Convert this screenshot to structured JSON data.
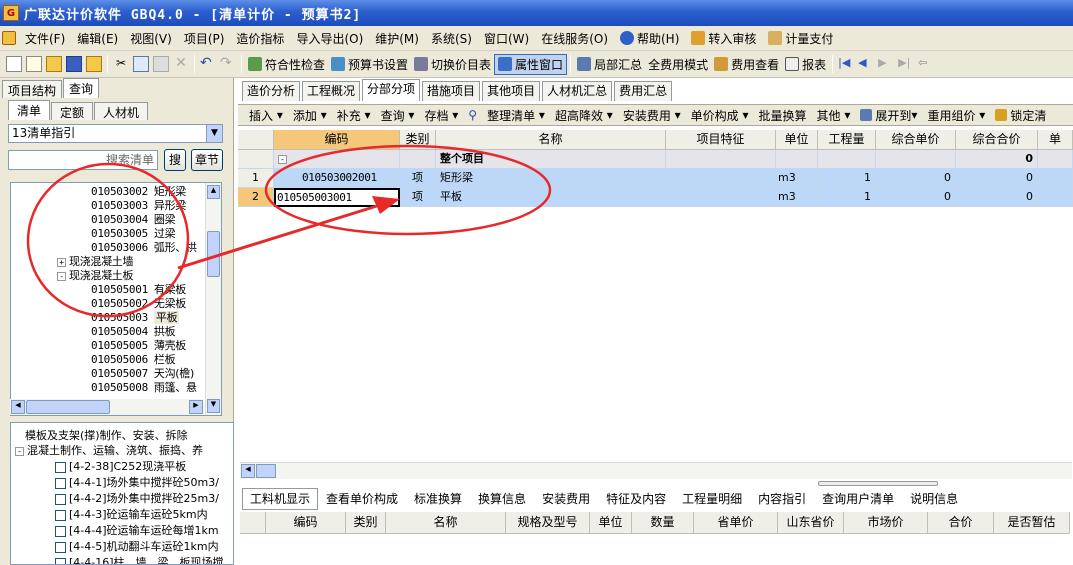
{
  "window": {
    "title": "广联达计价软件 GBQ4.0 - [清单计价 - 预算书2]"
  },
  "menu": [
    "文件(F)",
    "编辑(E)",
    "视图(V)",
    "项目(P)",
    "造价指标",
    "导入导出(O)",
    "维护(M)",
    "系统(S)",
    "窗口(W)",
    "在线服务(O)",
    "帮助(H)",
    "转入审核",
    "计量支付"
  ],
  "toolbar": {
    "check": "符合性检查",
    "budget_settings": "预算书设置",
    "switch_price": "切换价目表",
    "property_window": "属性窗口",
    "local_summary": "局部汇总",
    "all_fee_mode": "全费用模式",
    "fee_view": "费用查看",
    "report": "报表"
  },
  "left": {
    "top_tabs": [
      "项目结构",
      "查询"
    ],
    "sub_tabs": [
      "清单",
      "定额",
      "人材机"
    ],
    "library": "13清单指引",
    "search_placeholder": "搜索清单",
    "search_btn": "搜",
    "chapter_btn": "章节",
    "tree": [
      {
        "code": "010503002",
        "name": "矩形梁"
      },
      {
        "code": "010503003",
        "name": "异形梁"
      },
      {
        "code": "010503004",
        "name": "圈梁"
      },
      {
        "code": "010503005",
        "name": "过梁"
      },
      {
        "code": "010503006",
        "name": "弧形、拱"
      },
      {
        "group": "现浇混凝土墙",
        "expander": "+"
      },
      {
        "group": "现浇混凝土板",
        "expander": "-"
      },
      {
        "code": "010505001",
        "name": "有梁板"
      },
      {
        "code": "010505002",
        "name": "无梁板"
      },
      {
        "code": "010505003",
        "name": "平板"
      },
      {
        "code": "010505004",
        "name": "拱板"
      },
      {
        "code": "010505005",
        "name": "薄壳板"
      },
      {
        "code": "010505006",
        "name": "栏板"
      },
      {
        "code": "010505007",
        "name": "天沟(檐)"
      },
      {
        "code": "010505008",
        "name": "雨篷、悬"
      }
    ],
    "quota": [
      {
        "text": "模板及支架(撑)制作、安装、拆除"
      },
      {
        "text": "混凝土制作、运输、浇筑、振捣、养",
        "expander": "-"
      },
      {
        "text": "[4-2-38]C252现浇平板"
      },
      {
        "text": "[4-4-1]场外集中搅拌砼50m3/"
      },
      {
        "text": "[4-4-2]场外集中搅拌砼25m3/"
      },
      {
        "text": "[4-4-3]砼运输车运砼5km内"
      },
      {
        "text": "[4-4-4]砼运输车运砼每增1km"
      },
      {
        "text": "[4-4-5]机动翻斗车运砼1km内"
      },
      {
        "text": "[4-4-16]柱、墙、梁、板现场搅"
      }
    ]
  },
  "main": {
    "tabs": [
      "造价分析",
      "工程概况",
      "分部分项",
      "措施项目",
      "其他项目",
      "人材机汇总",
      "费用汇总"
    ],
    "tools": [
      "插入",
      "添加",
      "补充",
      "查询",
      "存档",
      "整理清单",
      "超高降效",
      "安装费用",
      "单价构成",
      "批量换算",
      "其他",
      "展开到",
      "重用组价",
      "锁定清"
    ],
    "columns": [
      "编码",
      "类别",
      "名称",
      "项目特征",
      "单位",
      "工程量",
      "综合单价",
      "综合合价"
    ],
    "total_row": {
      "name": "整个项目",
      "total": "0",
      "expander": "-"
    },
    "rows": [
      {
        "no": "1",
        "code": "010503002001",
        "type": "项",
        "name": "矩形梁",
        "unit": "m3",
        "qty": "1",
        "price": "0",
        "total": "0"
      },
      {
        "no": "2",
        "code": "010505003001",
        "type": "项",
        "name": "平板",
        "unit": "m3",
        "qty": "1",
        "price": "0",
        "total": "0"
      }
    ],
    "bottom_tabs": [
      "工料机显示",
      "查看单价构成",
      "标准换算",
      "换算信息",
      "安装费用",
      "特征及内容",
      "工程量明细",
      "内容指引",
      "查询用户清单",
      "说明信息"
    ],
    "bottom_columns": [
      "编码",
      "类别",
      "名称",
      "规格及型号",
      "单位",
      "数量",
      "省单价",
      "山东省价",
      "市场价",
      "合价",
      "是否暂估"
    ]
  },
  "colors": {
    "title_bg": "#2c5fce",
    "row_bg": "#bcd7f7",
    "annotation": "#e8292a"
  }
}
